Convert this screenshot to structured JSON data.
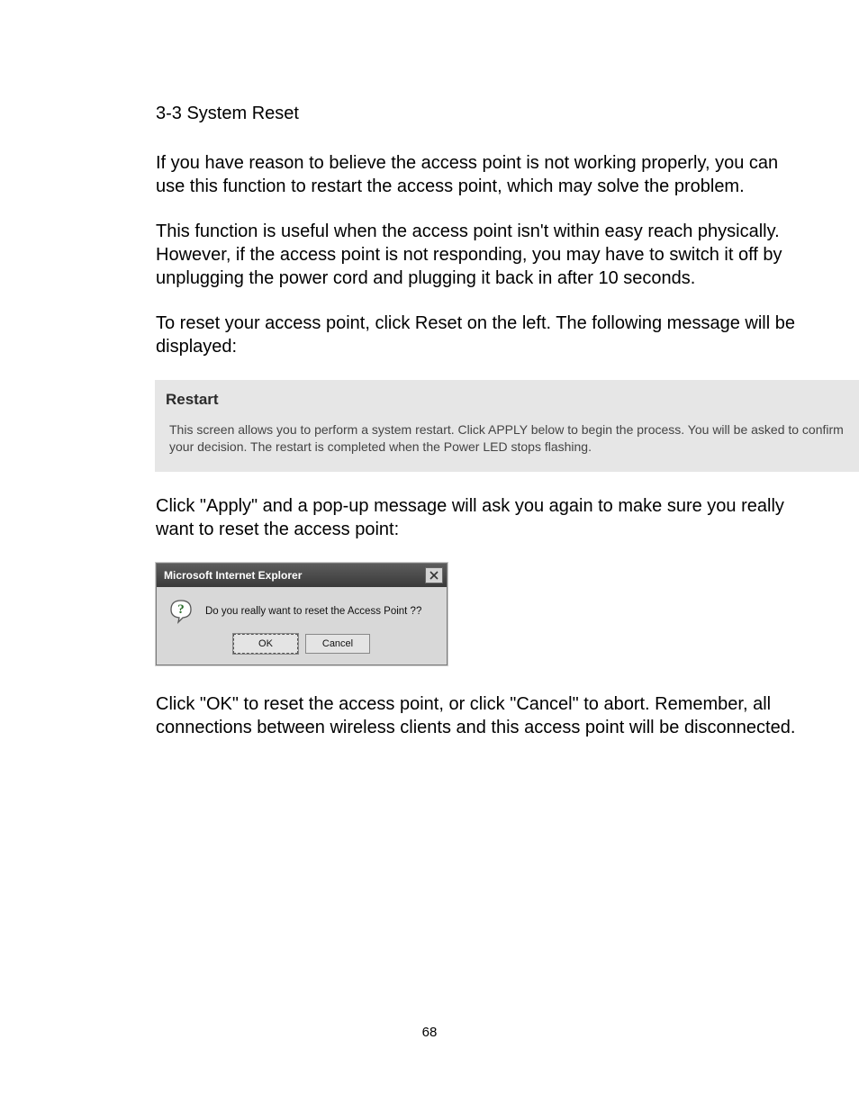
{
  "section_title": "3-3 System Reset",
  "para1": "If you have reason to believe the access point is not working properly, you can use this function to restart the access point, which may solve the problem.",
  "para2": "This function is useful when the access point isn't within easy reach physically. However, if the access point is not responding, you may have to switch it off by unplugging the power cord and plugging it back in after 10 seconds.",
  "para3": "To reset your access point, click Reset on the left. The following message will be displayed:",
  "restart_box": {
    "title": "Restart",
    "desc": "This screen allows you to perform a system restart. Click APPLY below to begin the process. You will be asked to confirm your decision. The restart is completed when the Power LED stops flashing."
  },
  "para4": "Click \"Apply\" and a pop-up message will ask you again to make sure you really want to reset the access point:",
  "dialog": {
    "title": "Microsoft Internet Explorer",
    "message": "Do you really want to reset the Access Point ??",
    "ok": "OK",
    "cancel": "Cancel"
  },
  "para5": "Click \"OK\" to reset the access point, or click \"Cancel\" to abort. Remember, all connections between wireless clients and this access point will be disconnected.",
  "page_number": "68"
}
